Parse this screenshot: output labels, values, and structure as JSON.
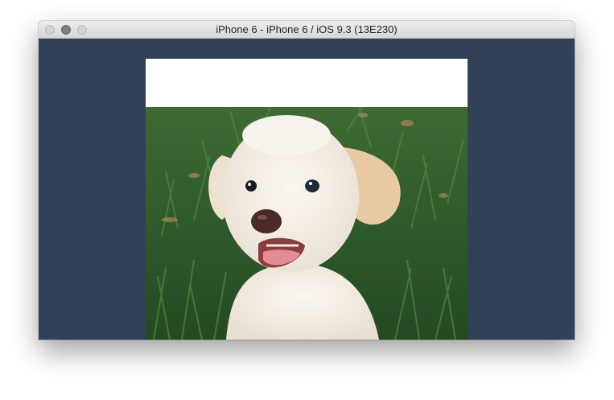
{
  "window": {
    "title": "iPhone 6 - iPhone 6 / iOS 9.3 (13E230)"
  },
  "colors": {
    "simulator_background": "#334158",
    "header_band": "#ffffff",
    "grass": "#2f5a2a",
    "puppy_fur": "#f3ece3",
    "puppy_ears": "#e8caa3"
  },
  "icons": {
    "close": "close-button-icon",
    "minimize": "minimize-button-icon",
    "zoom": "zoom-button-icon"
  }
}
